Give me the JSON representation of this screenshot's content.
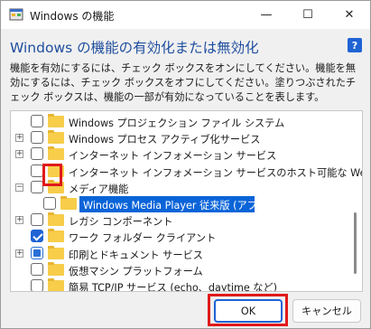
{
  "window": {
    "title": "Windows の機能",
    "minimize_glyph": "—",
    "maximize_glyph": "☐",
    "close_glyph": "✕"
  },
  "header": {
    "heading": "Windows の機能の有効化または無効化",
    "help_glyph": "?"
  },
  "description": "機能を有効にするには、チェック ボックスをオンにしてください。機能を無効にするには、チェック ボックスをオフにしてください。塗りつぶされたチェック ボックスは、機能の一部が有効になっていることを表します。",
  "tree": {
    "items": [
      {
        "label": "Windows プロジェクション ファイル システム",
        "expander": "",
        "state": "unchecked",
        "indent": 0
      },
      {
        "label": "Windows プロセス アクティブ化サービス",
        "expander": "+",
        "state": "unchecked",
        "indent": 0
      },
      {
        "label": "インターネット インフォメーション サービス",
        "expander": "+",
        "state": "unchecked",
        "indent": 0
      },
      {
        "label": "インターネット インフォメーション サービスのホスト可能な Web コア",
        "expander": "",
        "state": "unchecked",
        "indent": 0
      },
      {
        "label": "メディア機能",
        "expander": "−",
        "state": "unchecked",
        "indent": 0
      },
      {
        "label": "Windows Media Player 従来版 (アプリ)",
        "expander": "",
        "state": "unchecked",
        "indent": 1,
        "selected": true
      },
      {
        "label": "レガシ コンポーネント",
        "expander": "+",
        "state": "unchecked",
        "indent": 0
      },
      {
        "label": "ワーク フォルダー クライアント",
        "expander": "",
        "state": "checked",
        "indent": 0
      },
      {
        "label": "印刷とドキュメント サービス",
        "expander": "+",
        "state": "partial",
        "indent": 0
      },
      {
        "label": "仮想マシン プラットフォーム",
        "expander": "",
        "state": "unchecked",
        "indent": 0
      },
      {
        "label": "簡易 TCP/IP サービス (echo、daytime など)",
        "expander": "",
        "state": "unchecked",
        "indent": 0
      }
    ]
  },
  "buttons": {
    "ok": "OK",
    "cancel": "キャンセル"
  },
  "colors": {
    "accent": "#1f63d4",
    "highlight": "#e01a1a",
    "heading": "#1f4e9e",
    "selection": "#0a64d8"
  }
}
